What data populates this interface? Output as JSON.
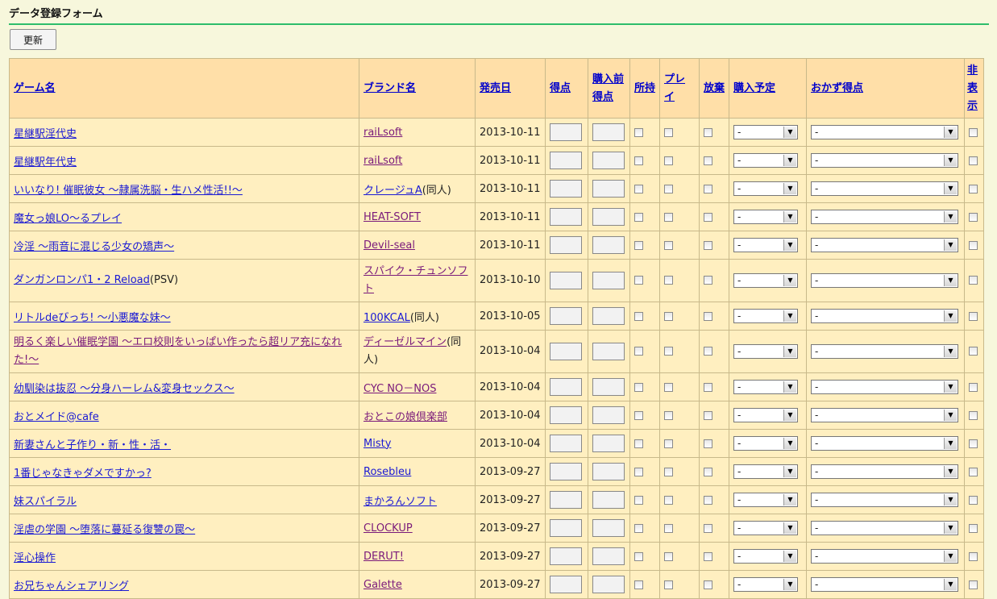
{
  "page": {
    "title": "データ登録フォーム",
    "refresh_label": "更新"
  },
  "columns": {
    "game": "ゲーム名",
    "brand": "ブランド名",
    "release": "発売日",
    "score": "得点",
    "prescore_1": "購入前",
    "prescore_2": "得点",
    "owned": "所持",
    "played": "プレイ",
    "abandoned": "放棄",
    "purchase_plan": "購入予定",
    "okazu_score": "おかず得点",
    "hide_1": "非",
    "hide_2": "表",
    "hide_3": "示"
  },
  "rows": [
    {
      "game": "星継駅淫代史",
      "game_suffix": "",
      "brand": "raiLsoft",
      "brand_suffix": "",
      "date": "2013-10-11",
      "plan": "-",
      "okazu": "-"
    },
    {
      "game": "星継駅年代史",
      "game_suffix": "",
      "brand": "raiLsoft",
      "brand_suffix": "",
      "date": "2013-10-11",
      "plan": "-",
      "okazu": "-"
    },
    {
      "game": "いいなり! 催眠彼女 ～隷属洗脳・生ハメ性活!!～",
      "game_suffix": "",
      "brand": "クレージュA",
      "brand_suffix": "(同人)",
      "date": "2013-10-11",
      "plan": "-",
      "okazu": "-"
    },
    {
      "game": "魔女っ娘LO～るプレイ",
      "game_suffix": "",
      "brand": "HEAT-SOFT",
      "brand_suffix": "",
      "date": "2013-10-11",
      "plan": "-",
      "okazu": "-"
    },
    {
      "game": "冷淫 ～雨音に混じる少女の矯声～",
      "game_suffix": "",
      "brand": "Devil-seal",
      "brand_suffix": "",
      "date": "2013-10-11",
      "plan": "-",
      "okazu": "-"
    },
    {
      "game": "ダンガンロンパ1・2 Reload",
      "game_suffix": "(PSV)",
      "brand": "スパイク・チュンソフト",
      "brand_suffix": "",
      "date": "2013-10-10",
      "plan": "-",
      "okazu": "-"
    },
    {
      "game": "リトルdeびっち! ～小悪魔な妹～",
      "game_suffix": "",
      "brand": "100KCAL",
      "brand_suffix": "(同人)",
      "date": "2013-10-05",
      "plan": "-",
      "okazu": "-"
    },
    {
      "game": "明るく楽しい催眠学園 ～エロ校則をいっぱい作ったら超リア充になれた!～",
      "game_suffix": "",
      "brand": "ディーゼルマイン",
      "brand_suffix": "(同人)",
      "date": "2013-10-04",
      "plan": "-",
      "okazu": "-"
    },
    {
      "game": "幼馴染は抜忍 ～分身ハーレム&変身セックス～",
      "game_suffix": "",
      "brand": "CYC NO－NOS",
      "brand_suffix": "",
      "date": "2013-10-04",
      "plan": "-",
      "okazu": "-"
    },
    {
      "game": "おとメイド@cafe",
      "game_suffix": "",
      "brand": "おとこの娘倶楽部",
      "brand_suffix": "",
      "date": "2013-10-04",
      "plan": "-",
      "okazu": "-"
    },
    {
      "game": "新妻さんと子作り・新・性・活・",
      "game_suffix": "",
      "brand": "Misty",
      "brand_suffix": "",
      "date": "2013-10-04",
      "plan": "-",
      "okazu": "-"
    },
    {
      "game": "1番じゃなきゃダメですかっ?",
      "game_suffix": "",
      "brand": "Rosebleu",
      "brand_suffix": "",
      "date": "2013-09-27",
      "plan": "-",
      "okazu": "-"
    },
    {
      "game": "妹スパイラル",
      "game_suffix": "",
      "brand": "まかろんソフト",
      "brand_suffix": "",
      "date": "2013-09-27",
      "plan": "-",
      "okazu": "-"
    },
    {
      "game": "淫虐の学園 ～堕落に蔓延る復讐の罠～",
      "game_suffix": "",
      "brand": "CLOCKUP",
      "brand_suffix": "",
      "date": "2013-09-27",
      "plan": "-",
      "okazu": "-"
    },
    {
      "game": "淫心操作",
      "game_suffix": "",
      "brand": "DERUT!",
      "brand_suffix": "",
      "date": "2013-09-27",
      "plan": "-",
      "okazu": "-"
    },
    {
      "game": "お兄ちゃんシェアリング",
      "game_suffix": "",
      "brand": "Galette",
      "brand_suffix": "",
      "date": "2013-09-27",
      "plan": "-",
      "okazu": "-"
    }
  ]
}
